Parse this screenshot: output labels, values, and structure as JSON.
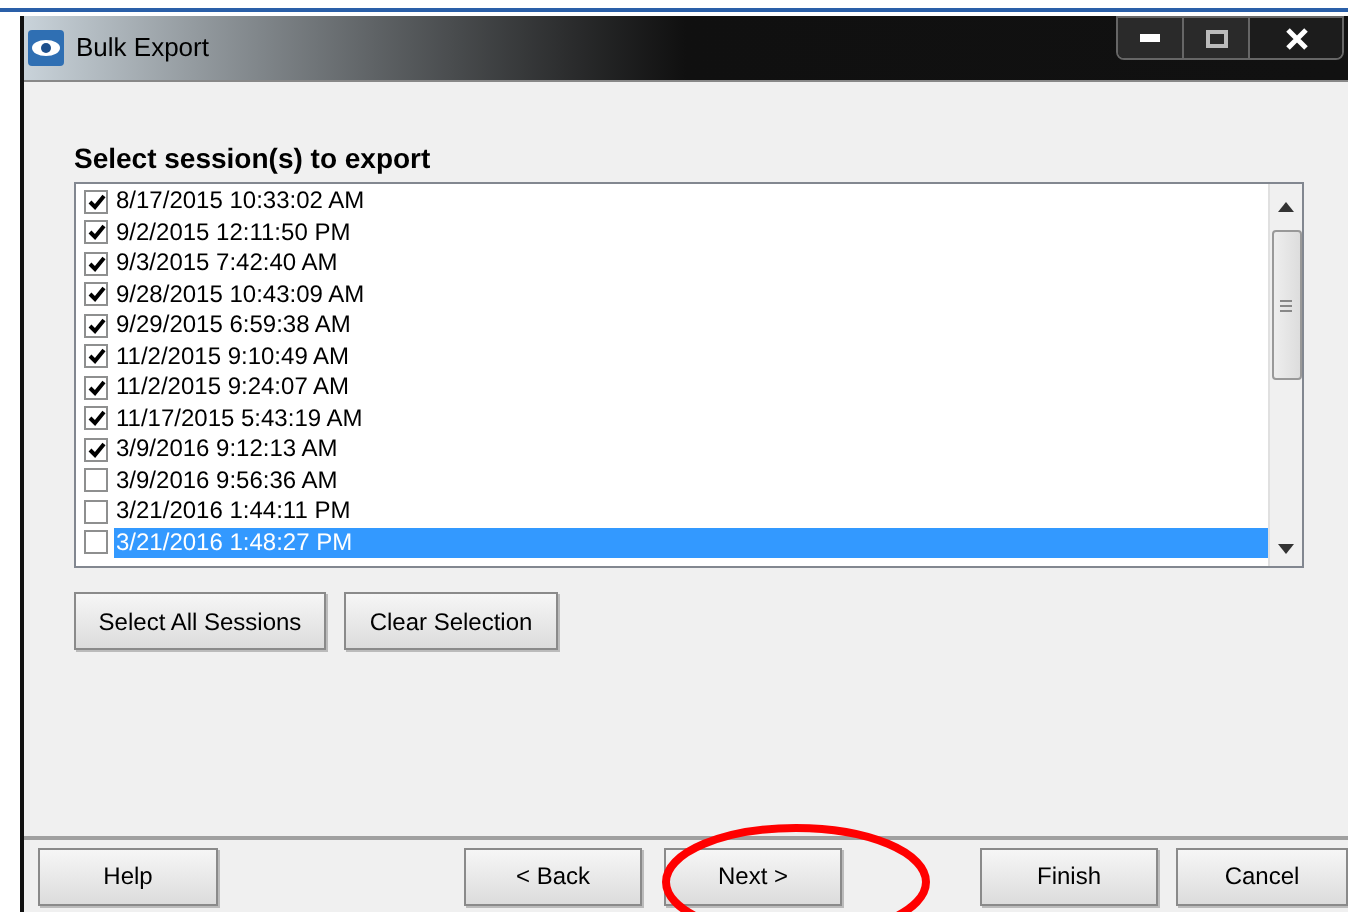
{
  "window": {
    "title": "Bulk Export"
  },
  "heading": "Select session(s) to export",
  "sessions": [
    {
      "label": "8/17/2015 10:33:02 AM",
      "checked": true,
      "selected": false
    },
    {
      "label": "9/2/2015 12:11:50 PM",
      "checked": true,
      "selected": false
    },
    {
      "label": "9/3/2015 7:42:40 AM",
      "checked": true,
      "selected": false
    },
    {
      "label": "9/28/2015 10:43:09 AM",
      "checked": true,
      "selected": false
    },
    {
      "label": "9/29/2015 6:59:38 AM",
      "checked": true,
      "selected": false
    },
    {
      "label": "11/2/2015 9:10:49 AM",
      "checked": true,
      "selected": false
    },
    {
      "label": "11/2/2015 9:24:07 AM",
      "checked": true,
      "selected": false
    },
    {
      "label": "11/17/2015 5:43:19 AM",
      "checked": true,
      "selected": false
    },
    {
      "label": "3/9/2016 9:12:13 AM",
      "checked": true,
      "selected": false
    },
    {
      "label": "3/9/2016 9:56:36 AM",
      "checked": false,
      "selected": false
    },
    {
      "label": "3/21/2016 1:44:11 PM",
      "checked": false,
      "selected": false
    },
    {
      "label": "3/21/2016 1:48:27 PM",
      "checked": false,
      "selected": true
    }
  ],
  "list_buttons": [
    "Select All Sessions",
    "Clear Selection"
  ],
  "footer": {
    "help": "Help",
    "back": "< Back",
    "next": "Next >",
    "finish": "Finish",
    "cancel": "Cancel"
  },
  "annotation": {
    "kind": "ellipse",
    "color": "#ff0000"
  }
}
